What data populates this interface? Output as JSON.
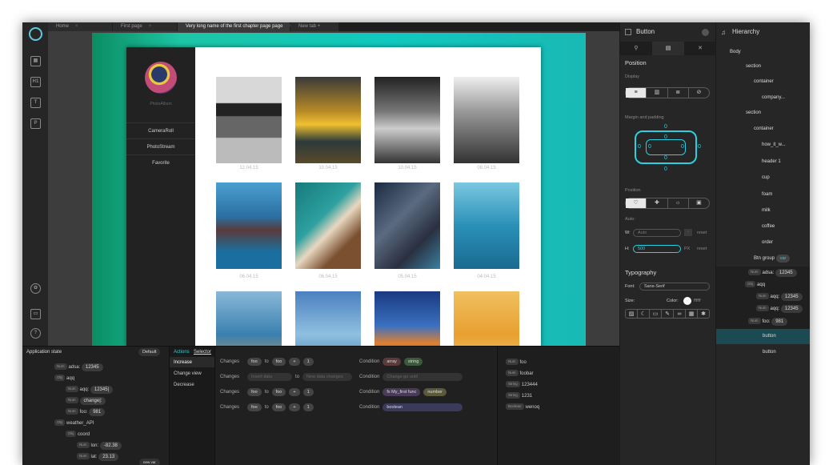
{
  "tabs": [
    {
      "label": "Home"
    },
    {
      "label": "First page"
    },
    {
      "label": "Very long name of the first chapter page page"
    },
    {
      "label": "New tab +"
    }
  ],
  "album": {
    "name": "PhotoAlbum",
    "menu": [
      "CameraRoll",
      "PhotoStream",
      "Favorite"
    ],
    "dates": [
      "12.04.15",
      "10.04.15",
      "10.04.15",
      "08.04.15",
      "06.04.15",
      "06.04.15",
      "05.04.15",
      "04.04.15"
    ]
  },
  "inspector": {
    "title": "Button",
    "section_position": "Position",
    "display_label": "Display",
    "margin_label": "Margin and padding",
    "margin_value": "0",
    "position_label": "Position",
    "auto_label": "Auto:",
    "w_label": "W:",
    "w_placeholder": "Auto",
    "h_label": "H:",
    "h_value": "500",
    "px": "PX",
    "reset": "reset",
    "dash": "-",
    "typography": "Typography",
    "font_label": "Font:",
    "font_value": "Sans-Serif",
    "size_label": "Size:",
    "color_label": "Color:",
    "color_hex": "ffffff"
  },
  "hierarchy": {
    "title": "Hierarchy",
    "items": [
      {
        "label": "Body"
      },
      {
        "label": "section"
      },
      {
        "label": "container"
      },
      {
        "label": "company..."
      },
      {
        "label": "section"
      },
      {
        "label": "container"
      },
      {
        "label": "how_it_w..."
      },
      {
        "label": "header 1"
      },
      {
        "label": "cup"
      },
      {
        "label": "foam"
      },
      {
        "label": "milk"
      },
      {
        "label": "coffee"
      },
      {
        "label": "order"
      },
      {
        "label": "Btn group",
        "badge": "var"
      },
      {
        "tag": "Num",
        "key": "adsa:",
        "value": "12345"
      },
      {
        "tag": "Obj",
        "key": "aqq"
      },
      {
        "tag": "Num",
        "key": "aqq:",
        "value": "12345"
      },
      {
        "tag": "Num",
        "key": "aqq:",
        "value": "12345"
      },
      {
        "tag": "Num",
        "key": "foo:",
        "value": "981"
      },
      {
        "label": "button"
      },
      {
        "label": "button"
      }
    ]
  },
  "app_state": {
    "title": "Application state",
    "default": "Default",
    "rows": [
      {
        "tag": "Num",
        "key": "adsa:",
        "value": "12345"
      },
      {
        "tag": "Obj",
        "key": "aqq"
      },
      {
        "tag": "Num",
        "key": "aqq:",
        "value": "12345|"
      },
      {
        "tag": "Num",
        "key": "change|:",
        "value": ""
      },
      {
        "tag": "Num",
        "key": "foo:",
        "value": "981"
      },
      {
        "tag": "Obj",
        "key": "weather_API"
      },
      {
        "tag": "Obj",
        "key": "coord"
      },
      {
        "tag": "Num",
        "key": "lon:",
        "value": "-82.38"
      },
      {
        "tag": "Num",
        "key": "lat:",
        "value": "23.13"
      }
    ],
    "new_var": "new var"
  },
  "actions": {
    "tab_actions": "Actions",
    "tab_selector": "Selector",
    "list": [
      "Increase",
      "Change view",
      "Decrease"
    ],
    "rows": [
      {
        "changes": "Changes",
        "a": "foo",
        "to": "to",
        "b": "foo",
        "op": "+",
        "n": "1",
        "cond": "Condition",
        "c1": "array",
        "c2": "string"
      },
      {
        "changes": "Changes",
        "a": "Insert data",
        "to": "to",
        "b": "New data changes",
        "cond": "Condition",
        "c1": "Change go until"
      },
      {
        "changes": "Changes",
        "a": "foo",
        "to": "to",
        "b": "foo",
        "op": "+",
        "n": "1",
        "cond": "Condition",
        "c1": "My_first func",
        "c2": "number",
        "fx": "fx"
      },
      {
        "changes": "Changes",
        "a": "foo",
        "to": "to",
        "b": "foo",
        "op": "+",
        "n": "1",
        "cond": "Condition",
        "c1": "boolean"
      }
    ]
  },
  "vars": [
    {
      "tag": "Num",
      "value": "foo"
    },
    {
      "tag": "Num",
      "value": "foobar"
    },
    {
      "tag": "String",
      "value": "123444"
    },
    {
      "tag": "String",
      "value": "1231"
    },
    {
      "tag": "Boolean",
      "value": "wenoq"
    }
  ]
}
